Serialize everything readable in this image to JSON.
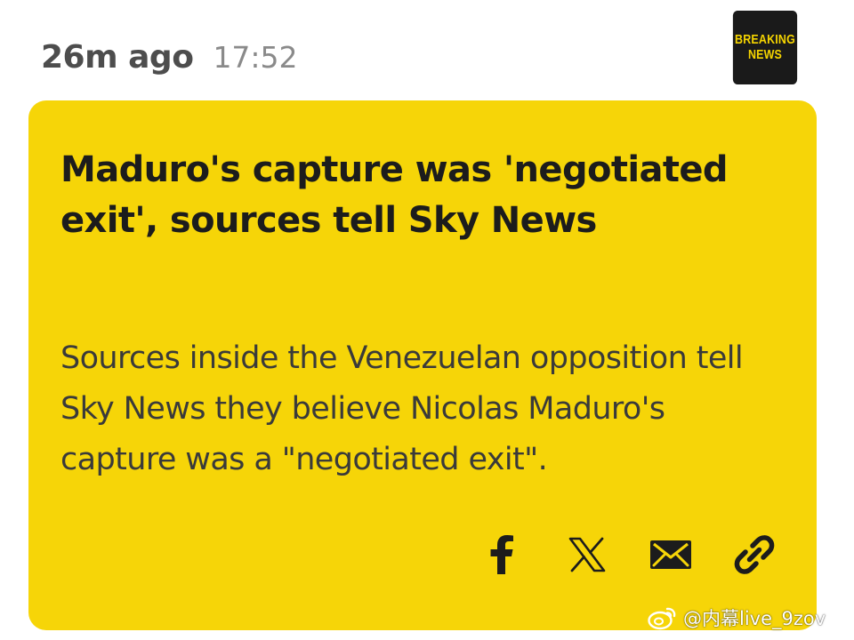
{
  "header": {
    "relative_time": "26m ago",
    "clock_time": "17:52",
    "badge": {
      "line1": "BREAKING",
      "line2": "NEWS"
    }
  },
  "article": {
    "headline": "Maduro's capture was 'negotiated exit', sources tell Sky News",
    "summary": "Sources inside the Venezuelan opposition tell Sky News they believe Nicolas Maduro's capture was a \"negotiated exit\"."
  },
  "share": {
    "buttons": [
      {
        "icon": "facebook-icon"
      },
      {
        "icon": "x-icon"
      },
      {
        "icon": "email-icon"
      },
      {
        "icon": "link-icon"
      }
    ]
  },
  "watermark": {
    "handle": "@内幕live_9zov",
    "icon": "weibo-icon"
  },
  "colors": {
    "card_background": "#f6d508",
    "badge_background": "#1a1a1a",
    "badge_text": "#f5d400",
    "headline_text": "#1c1c1c",
    "summary_text": "#3a3a3a"
  }
}
